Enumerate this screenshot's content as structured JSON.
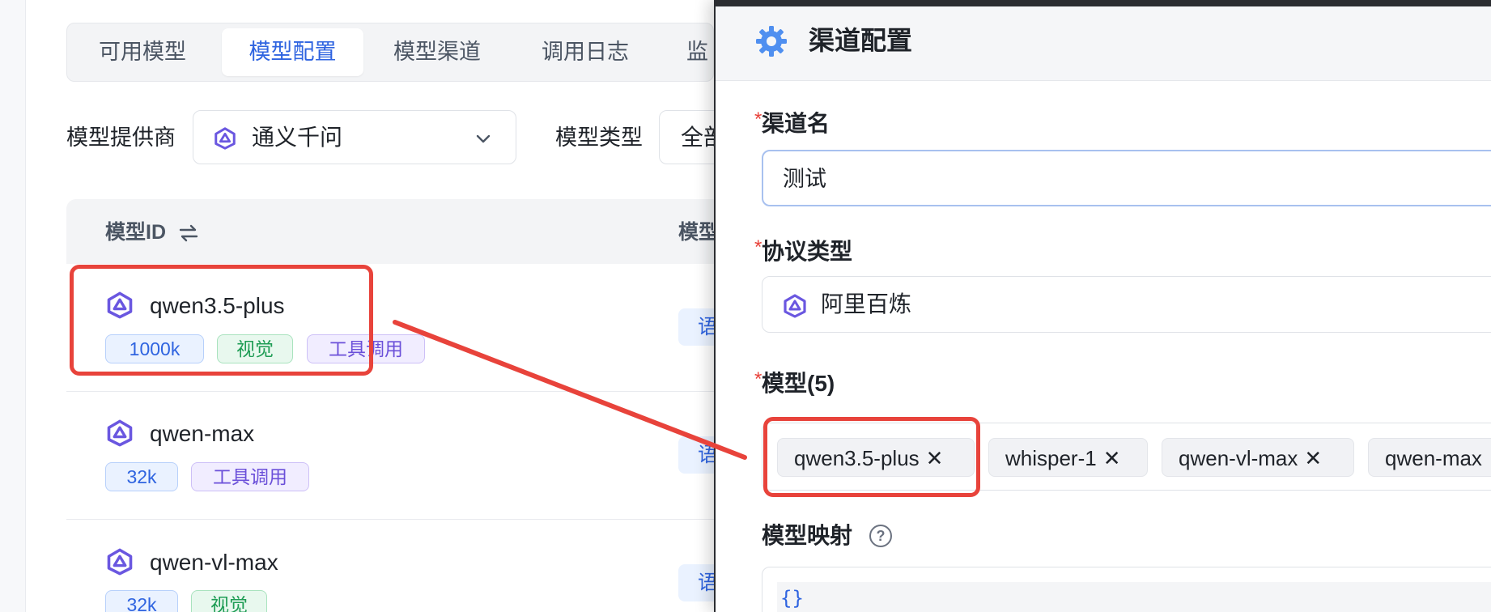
{
  "tabs": [
    {
      "label": "可用模型"
    },
    {
      "label": "模型配置"
    },
    {
      "label": "模型渠道"
    },
    {
      "label": "调用日志"
    },
    {
      "label": "监"
    }
  ],
  "filters": {
    "provider_label": "模型提供商",
    "provider_value": "通义千问",
    "type_label": "模型类型",
    "type_value": "全部"
  },
  "table": {
    "col_model_id": "模型ID",
    "col_type": "模型",
    "rows": [
      {
        "name": "qwen3.5-plus",
        "type": "语",
        "tags": [
          {
            "text": "1000k",
            "color": "blue"
          },
          {
            "text": "视觉",
            "color": "green"
          },
          {
            "text": "工具调用",
            "color": "purple"
          }
        ]
      },
      {
        "name": "qwen-max",
        "type": "语",
        "tags": [
          {
            "text": "32k",
            "color": "blue"
          },
          {
            "text": "工具调用",
            "color": "purple"
          }
        ]
      },
      {
        "name": "qwen-vl-max",
        "type": "语",
        "tags": [
          {
            "text": "32k",
            "color": "blue"
          },
          {
            "text": "视觉",
            "color": "green"
          }
        ]
      }
    ]
  },
  "drawer": {
    "title": "渠道配置",
    "channel_name_label": "渠道名",
    "channel_name_value": "测试",
    "protocol_label": "协议类型",
    "protocol_value": "阿里百炼",
    "models_label": "模型(5)",
    "models": [
      "qwen3.5-plus",
      "whisper-1",
      "qwen-vl-max",
      "qwen-max"
    ],
    "mapping_label": "模型映射",
    "mapping_value": "{}"
  },
  "colors": {
    "accent": "#2f64e0",
    "highlight": "#e8433b"
  }
}
